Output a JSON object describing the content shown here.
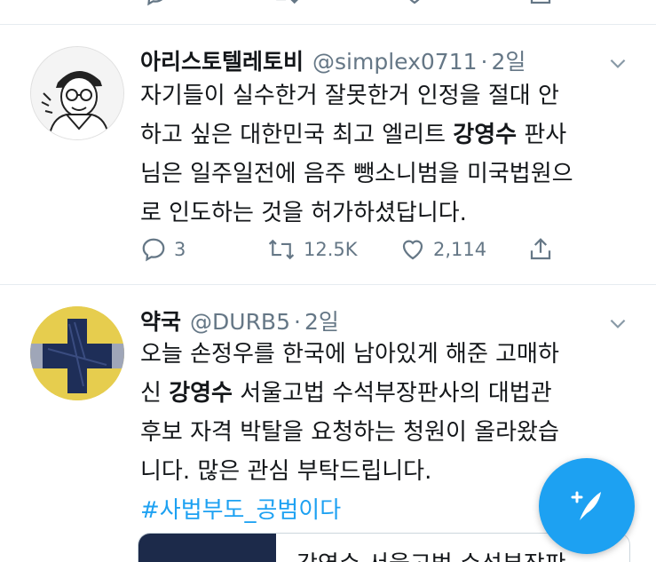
{
  "tweets": [
    {
      "name": "아리스토텔레토비",
      "handle": "@simplex0711",
      "separator": "·",
      "time": "2일",
      "lines": [
        [
          "자기들이 실수한거 잘못한거 인정을 절대 안",
          "",
          ""
        ],
        [
          "하고 싶은 대한민국 최고 엘리트 ",
          "강영수",
          " 판사"
        ],
        [
          "님은 일주일전에 음주 뺑소니범을 미국법원으",
          "",
          ""
        ],
        [
          "로 인도하는 것을 허가하셨답니다.",
          "",
          ""
        ]
      ],
      "replies": "3",
      "retweets": "12.5K",
      "likes": "2,114"
    },
    {
      "name": "약국",
      "handle": "@DURB5",
      "separator": "·",
      "time": "2일",
      "lines": [
        [
          "오늘 손정우를 한국에 남아있게 해준 고매하",
          "",
          ""
        ],
        [
          "신 ",
          "강영수",
          " 서울고법 수석부장판사의 대법관"
        ],
        [
          "후보 자격 박탈을 요청하는 청원이 올라왔습",
          "",
          ""
        ],
        [
          "니다. 많은 관심 부탁드립니다.",
          "",
          ""
        ]
      ],
      "hashtag": "#사법부도_공범이다",
      "card_title": "강영수 서울고법 수석부장판"
    }
  ],
  "icons": {
    "reply": "reply-icon",
    "retweet": "retweet-icon",
    "like": "heart-icon",
    "share": "share-icon",
    "menu": "chevron-down-icon",
    "compose": "compose-tweet-icon"
  },
  "colors": {
    "accent": "#1da1f2",
    "secondary_text": "#657786",
    "divider": "#e6ecf0"
  }
}
